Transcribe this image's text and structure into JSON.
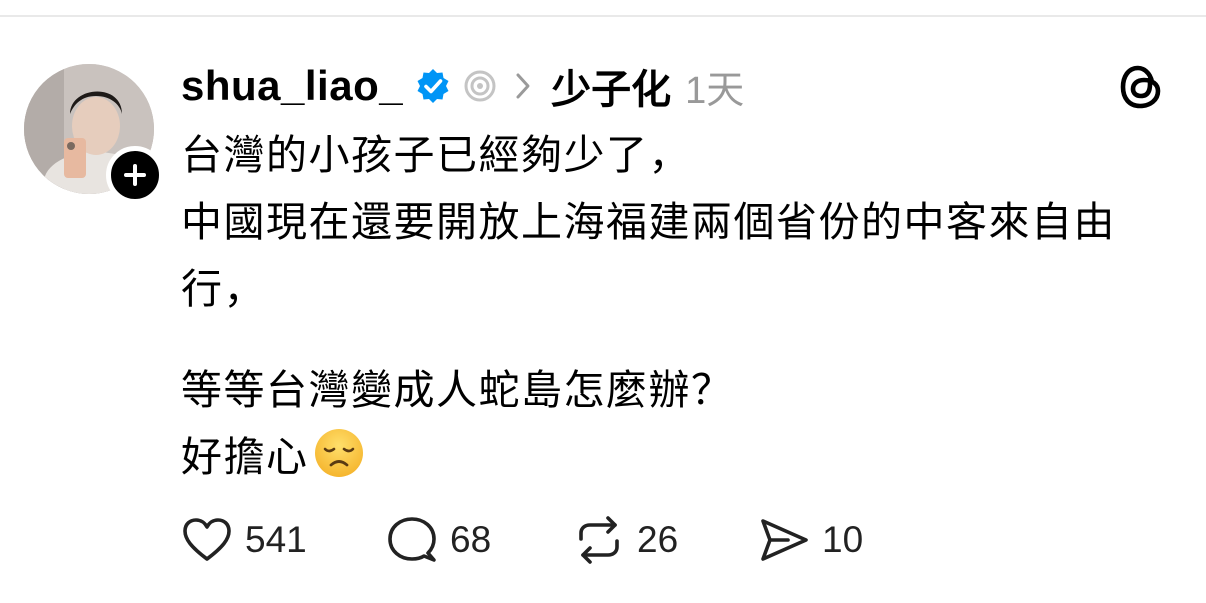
{
  "post": {
    "username": "shua_liao_",
    "topic": "少子化",
    "time_ago": "1天",
    "paragraphs": [
      "台灣的小孩子已經夠少了，",
      "中國現在還要開放上海福建兩個省份的中客來自由行，",
      "等等台灣變成人蛇島怎麼辦？",
      "好擔心"
    ],
    "emoji": "disappointed-face-emoji"
  },
  "actions": {
    "likes": "541",
    "replies": "68",
    "reposts": "26",
    "shares": "10"
  },
  "colors": {
    "text": "#000000",
    "muted": "#999999",
    "verified_blue": "#0095f6",
    "divider": "#e9e9e9"
  },
  "icons": [
    "verified-badge-icon",
    "activity-ring-icon",
    "chevron-right-icon",
    "threads-logo-icon",
    "heart-icon",
    "comment-icon",
    "repost-icon",
    "share-icon",
    "follow-plus-icon"
  ]
}
